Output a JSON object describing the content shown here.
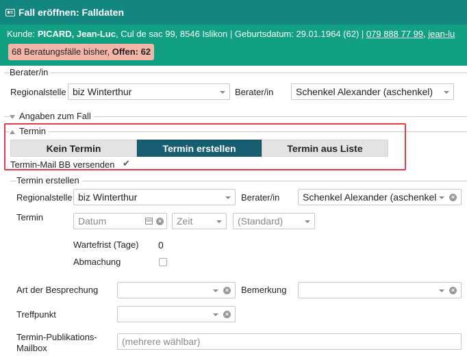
{
  "titlebar": {
    "icon": "id-card-icon",
    "title": "Fall eröffnen: Falldaten"
  },
  "client": {
    "prefix": "Kunde: ",
    "name": "PICARD, Jean-Luc",
    "address": ", Cul de sac 99, 8546 Islikon | Geburtsdatum: 29.01.1964 (62) | ",
    "phone": "079 888 77 99",
    "separator": ", ",
    "email_fragment": "jean-lu",
    "cases_prefix": "68 Beratungsfälle bisher, ",
    "open_label": "Offen: 62"
  },
  "berater_section": {
    "legend": "Berater/in",
    "region_label": "Regionalstelle",
    "region_value": "biz Winterthur",
    "berater_label": "Berater/in",
    "berater_value": "Schenkel Alexander (aschenkel)"
  },
  "angaben_section": {
    "legend": "Angaben zum Fall"
  },
  "termin_section": {
    "legend": "Termin",
    "tabs": [
      {
        "label": "Kein Termin",
        "active": false
      },
      {
        "label": "Termin erstellen",
        "active": true
      },
      {
        "label": "Termin aus Liste",
        "active": false
      }
    ],
    "mail_label": "Termin-Mail BB versenden",
    "mail_checked": true
  },
  "termin_erstellen": {
    "legend": "Termin erstellen",
    "region_label": "Regionalstelle",
    "region_value": "biz Winterthur",
    "berater_label": "Berater/in",
    "berater_value": "Schenkel Alexander (aschenkel",
    "termin_label": "Termin",
    "date_placeholder": "Datum",
    "time_placeholder": "Zeit",
    "standard_placeholder": "(Standard)",
    "wartefrist_label": "Wartefrist (Tage)",
    "wartefrist_value": "0",
    "abmachung_label": "Abmachung",
    "art_label": "Art der Besprechung",
    "bemerkung_label": "Bemerkung",
    "treffpunkt_label": "Treffpunkt",
    "mailbox_label_1": "Termin-Publikations-",
    "mailbox_label_2": "Mailbox",
    "mailbox_placeholder": "(mehrere wählbar)"
  }
}
